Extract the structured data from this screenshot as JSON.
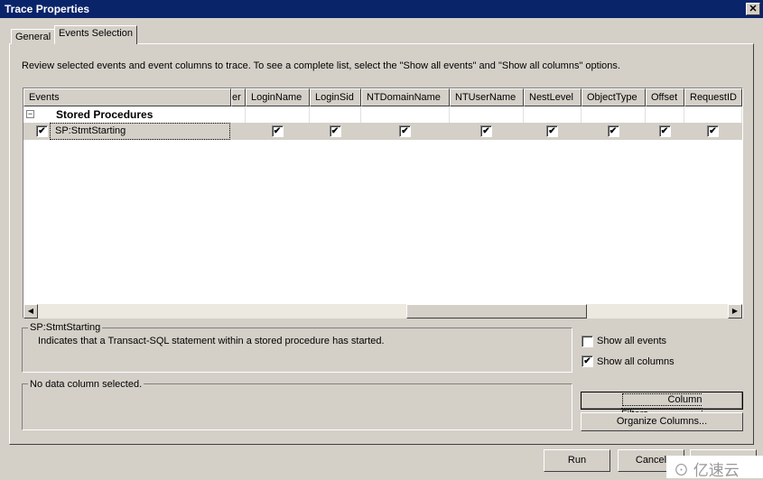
{
  "window": {
    "title": "Trace Properties",
    "close_icon": "close-icon"
  },
  "tabs": [
    {
      "label": "General",
      "active": false
    },
    {
      "label": "Events Selection",
      "active": true
    }
  ],
  "instructions": "Review selected events and event columns to trace. To see a complete list, select the \"Show all events\" and \"Show all columns\" options.",
  "grid": {
    "columns": [
      "Events",
      "er",
      "LoginName",
      "LoginSid",
      "NTDomainName",
      "NTUserName",
      "NestLevel",
      "ObjectType",
      "Offset",
      "RequestID"
    ],
    "group": {
      "label": "Stored Procedures",
      "expander": "−"
    },
    "rows": [
      {
        "event": "SP:StmtStarting",
        "selected": true,
        "checks": [
          true,
          true,
          true,
          true,
          true,
          true,
          true,
          true
        ]
      }
    ]
  },
  "description": {
    "title": "SP:StmtStarting",
    "text": "Indicates that a Transact-SQL statement within a stored procedure has started."
  },
  "column_info": {
    "text": "No data column selected."
  },
  "options": {
    "show_all_events": {
      "label": "Show all events",
      "checked": false
    },
    "show_all_columns": {
      "label": "Show all columns",
      "checked": true
    }
  },
  "buttons": {
    "column_filters": "Column Filters...",
    "organize_columns": "Organize Columns...",
    "run": "Run",
    "cancel": "Cancel"
  },
  "watermark": "亿速云"
}
